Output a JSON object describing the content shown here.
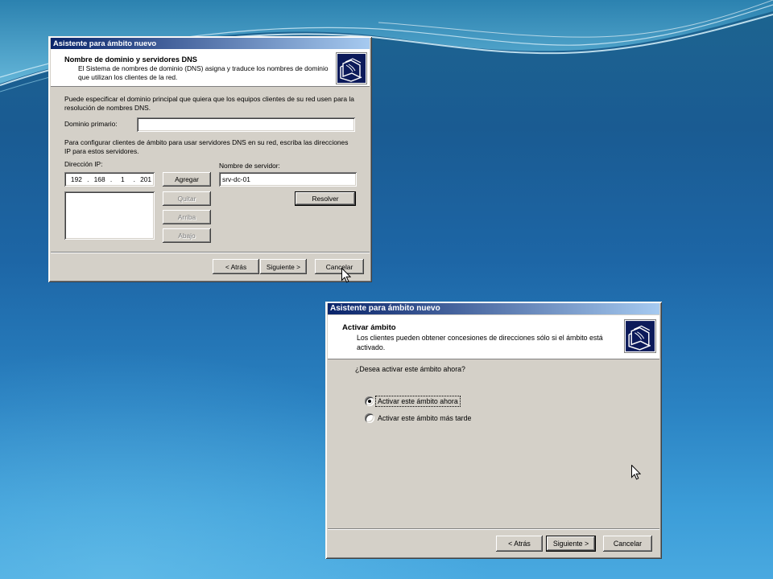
{
  "theme": {
    "titlebar_start": "#0a246a",
    "titlebar_end": "#a6caf0",
    "dialog_face": "#d4d0c8"
  },
  "dialog1": {
    "title": "Asistente para ámbito nuevo",
    "header": {
      "title": "Nombre de dominio y servidores DNS",
      "description": "El Sistema de nombres de dominio (DNS) asigna y traduce los nombres de dominio\nque utilizan los clientes de la red.",
      "icon": "wizard-folder-icon"
    },
    "domain": {
      "instructions": "Puede especificar el dominio principal que quiera que los equipos clientes de su red usen para la\nresolución de nombres DNS.",
      "label": "Dominio primario:",
      "value": ""
    },
    "dns_servers": {
      "instructions": "Para configurar clientes de ámbito para usar servidores DNS en su red, escriba las direcciones\nIP para estos servidores.",
      "ip_label": "Dirección IP:",
      "ip_octets": [
        "192",
        "168",
        "1",
        "201"
      ],
      "ip_separator": ".",
      "server_label": "Nombre de servidor:",
      "server_value": "srv-dc-01",
      "buttons": {
        "add": {
          "label": "Agregar",
          "disabled": false
        },
        "remove": {
          "label": "Quitar",
          "disabled": true
        },
        "up": {
          "label": "Arriba",
          "disabled": true
        },
        "down": {
          "label": "Abajo",
          "disabled": true
        },
        "resolve": {
          "label": "Resolver",
          "disabled": false
        }
      }
    },
    "nav": {
      "back": "< Atrás",
      "next": "Siguiente >",
      "cancel": "Cancelar"
    }
  },
  "dialog2": {
    "title": "Asistente para ámbito nuevo",
    "header": {
      "title": "Activar ámbito",
      "description": "Los clientes pueden obtener concesiones de direcciones sólo si el ámbito está\nactivado.",
      "icon": "wizard-folder-icon"
    },
    "question": "¿Desea activar este ámbito ahora?",
    "options": [
      {
        "label": "Activar este ámbito ahora",
        "selected": true
      },
      {
        "label": "Activar este ámbito más tarde",
        "selected": false
      }
    ],
    "nav": {
      "back": "< Atrás",
      "next": "Siguiente >",
      "cancel": "Cancelar"
    }
  }
}
